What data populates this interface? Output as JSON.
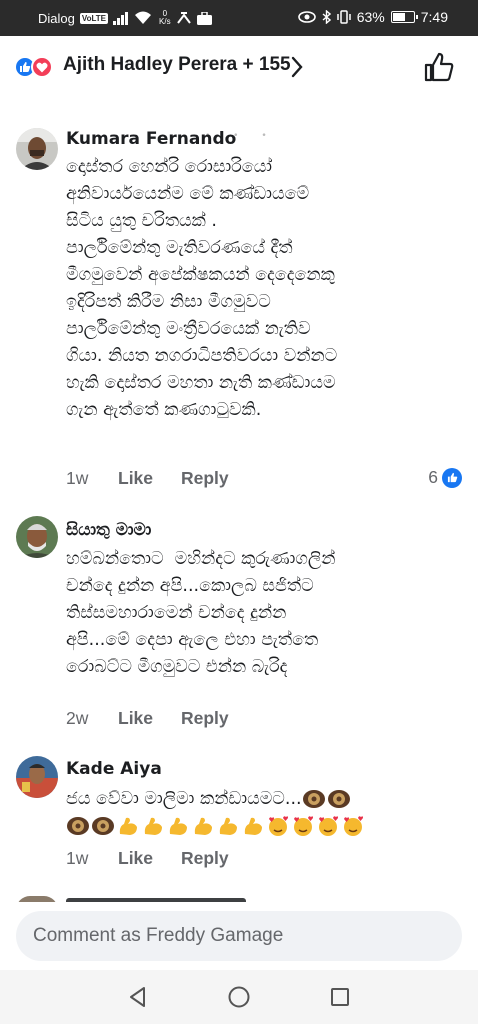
{
  "status_bar": {
    "carrier": "Dialog",
    "volte": "VoLTE",
    "net_speed_value": "0",
    "net_speed_unit": "K/s",
    "battery": "63%",
    "battery_level": 0.63,
    "time": "7:49"
  },
  "reactions": {
    "text": "Ajith Hadley Perera + 155"
  },
  "comments": [
    {
      "author": "Kumara Fernando",
      "text": "දොස්තර හෙන්රි රොසාරියෝ\nඅනිවාර්යයෙන්ම මේ කණ්ඩායමේ\nසිටිය යුතු චරිතයක් .\nපාර්ලිමේන්තු මැතිවරණයේ දීත්\nමීගමුවෙන් අපේක්ෂකයන් දෙදෙනෙකු\nඉදිරිපත් කිරීම නිසා මීගමුවට\nපාර්ලිමේන්තු මංත්‍රීවරයෙක් නැතිව\nගියා. නියත නගරාධිපතිවරයා වන්නට\nහැකි දොස්තර මහතා නැති කණ්ඩායම\nගැන ඇත්තේ කණගාටුවකි.",
      "time": "1w",
      "like": "Like",
      "reply": "Reply",
      "reaction_count": "6"
    },
    {
      "author": "සියාතු මාමා",
      "text": "හම්බන්තොට  මහින්දට කුරුණාගලින්\nචන්දෙ දුන්න අපි...කොලබ සජිත්ට\nතිස්සමහාරාමෙන් චන්දෙ දුන්න\nඅපි...මේ දෙපා ඇලෙ එහා පැත්තෙ\nරොබට්ට මීගමුවට එන්න බැරිද",
      "time": "2w",
      "like": "Like",
      "reply": "Reply"
    },
    {
      "author": "Kade Aiya",
      "text": "ජය වේවා මාලිමා කන්ඩායමට...",
      "time": "1w",
      "like": "Like",
      "reply": "Reply"
    }
  ],
  "composer": {
    "placeholder": "Comment as Freddy Gamage"
  },
  "icons": {
    "back": "back-triangle-icon",
    "home": "home-circle-icon",
    "recents": "recents-square-icon"
  }
}
